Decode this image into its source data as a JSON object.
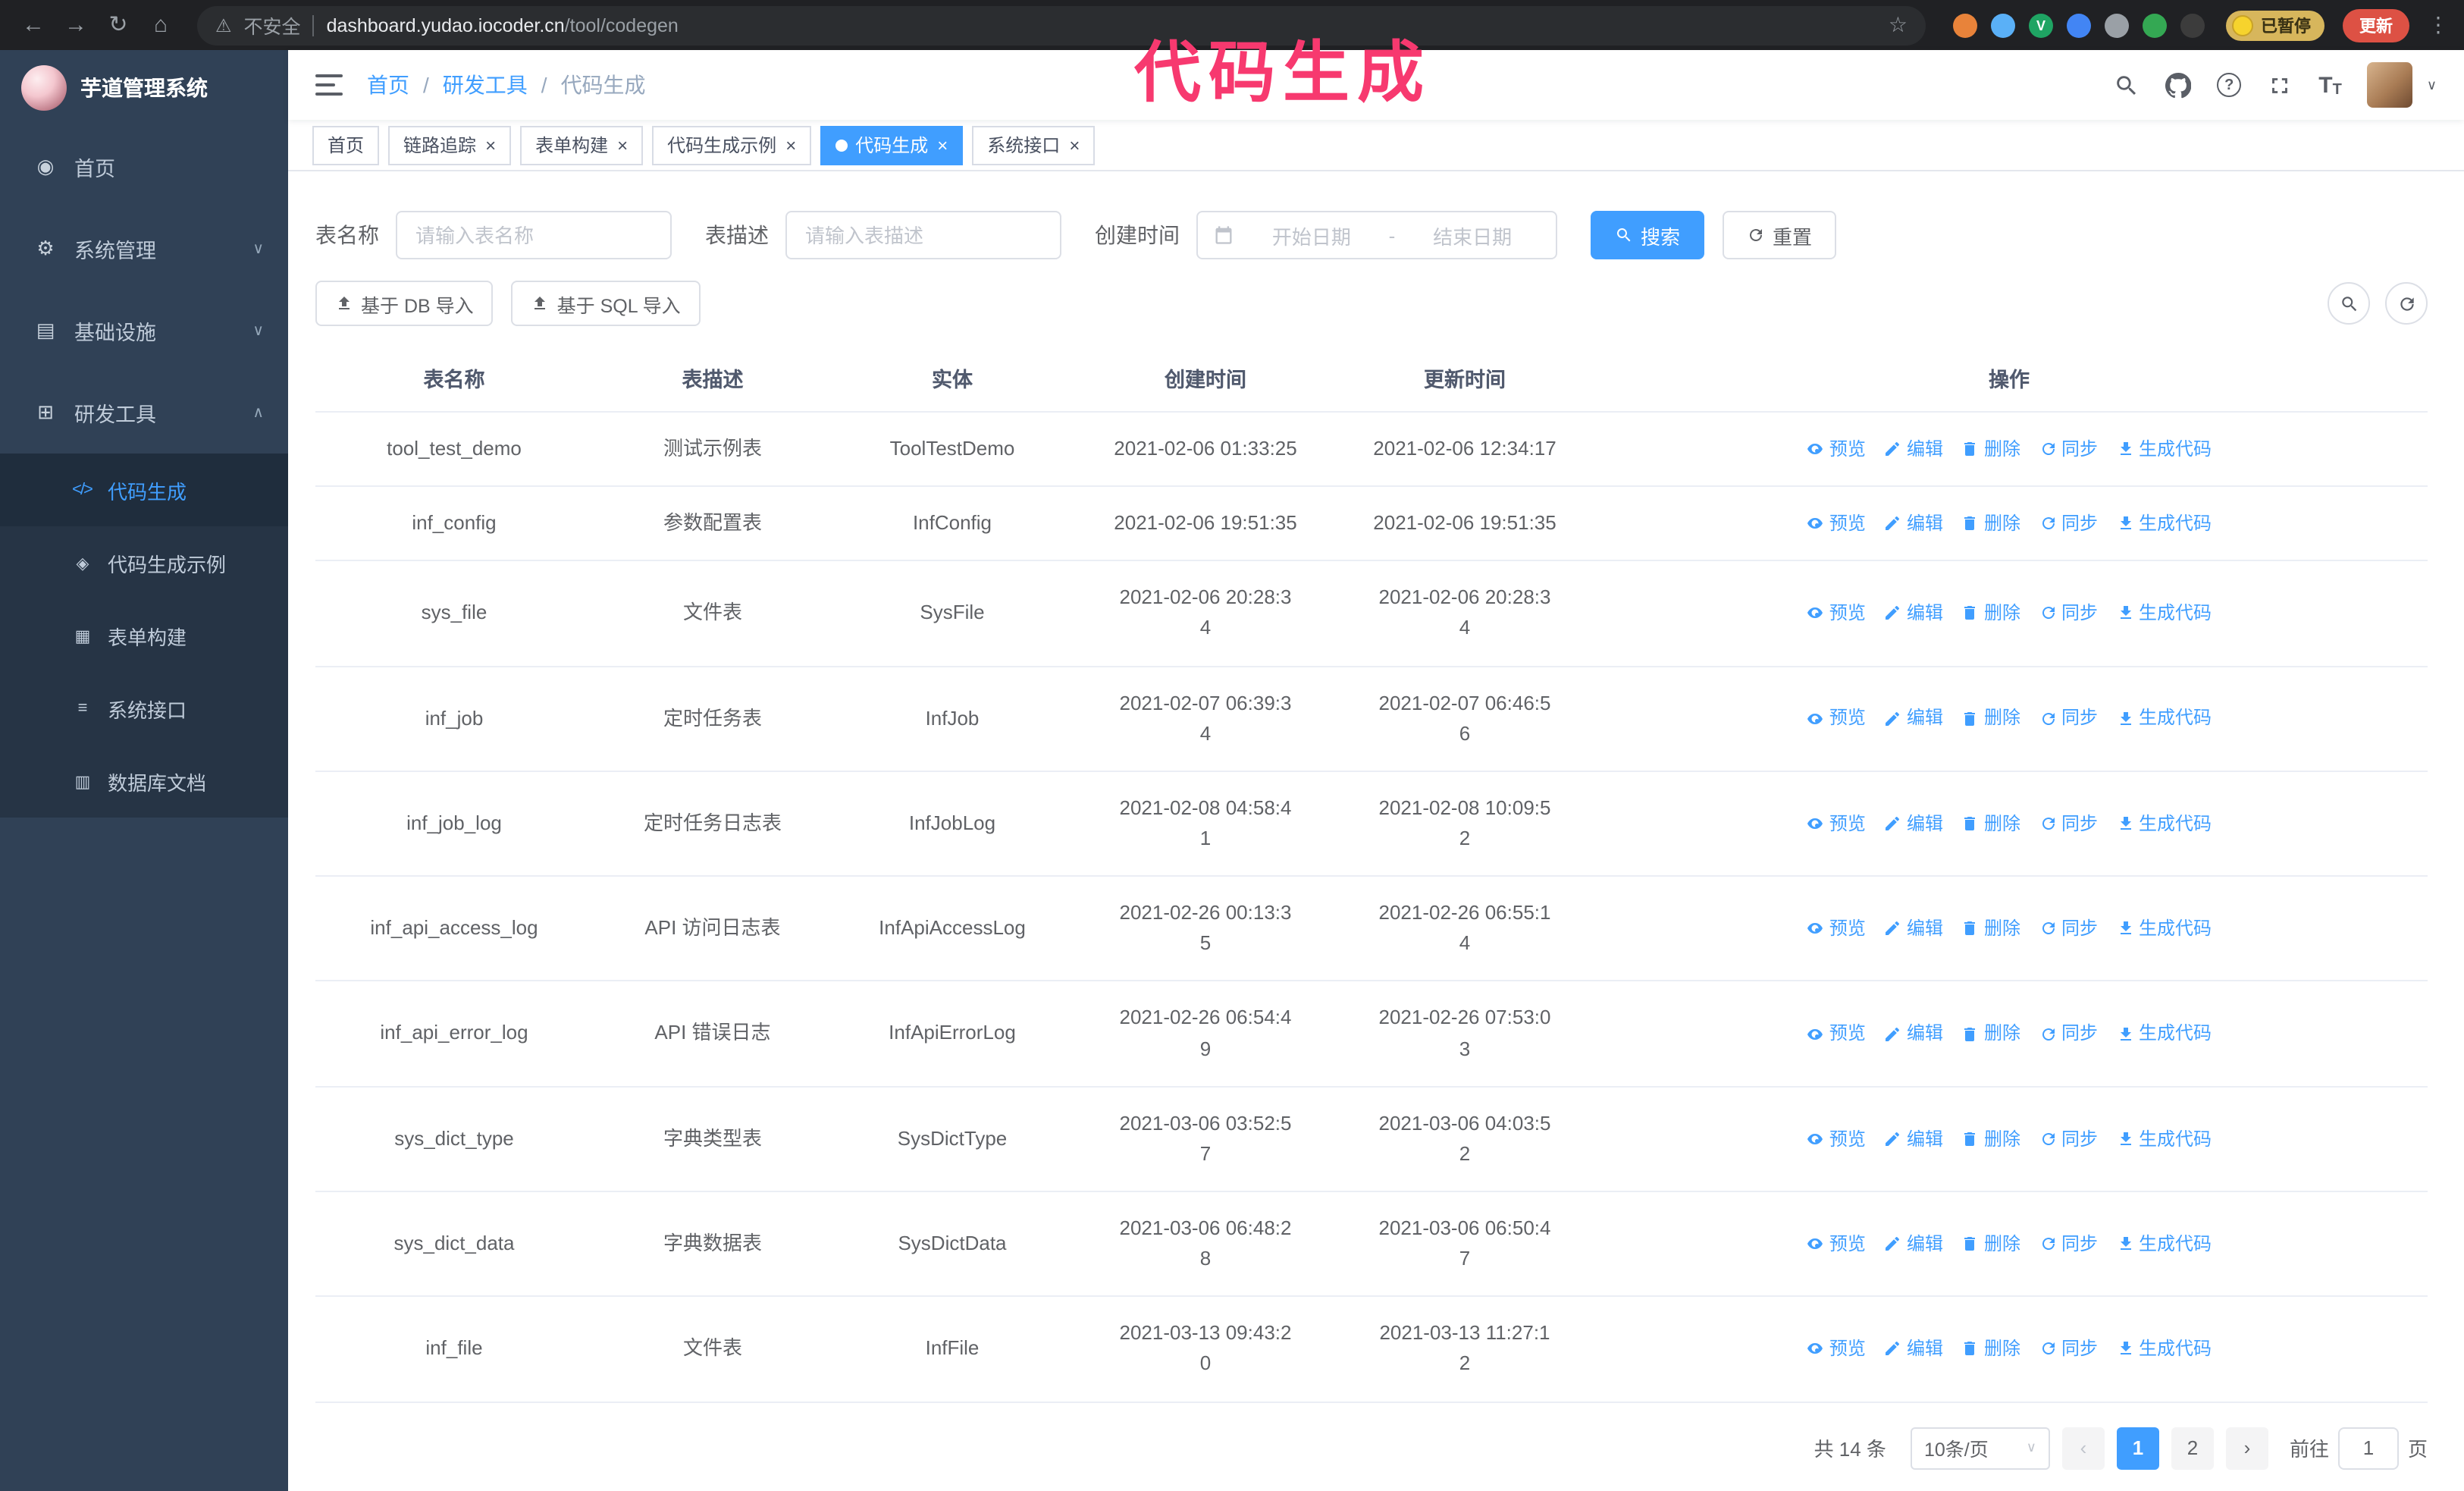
{
  "theme": {
    "primary": "#409eff",
    "sidebar_bg": "#304156",
    "annotation_color": "#f7396f",
    "tab_active_bg": "#409eff"
  },
  "annotation": {
    "text": "代码生成"
  },
  "browser": {
    "back_icon": "←",
    "forward_icon": "→",
    "reload_icon": "↻",
    "home_icon": "⌂",
    "warning_icon": "⚠",
    "security_label": "不安全",
    "url_host": "dashboard.yudao.iocoder.cn",
    "url_path": "/tool/codegen",
    "star_icon": "☆",
    "extensions": [
      {
        "color": "#e8833a",
        "label": ""
      },
      {
        "color": "#5ab0f7",
        "label": ""
      },
      {
        "color": "#1fa463",
        "label": "V"
      },
      {
        "color": "#4285f4",
        "label": ""
      },
      {
        "color": "#9aa0a6",
        "label": ""
      },
      {
        "color": "#34a853",
        "label": ""
      },
      {
        "color": "#3c3c3c",
        "label": ""
      }
    ],
    "paused_badge": "已暂停",
    "update_button": "更新",
    "menu_icon": "⋮"
  },
  "sidebar": {
    "logo_title": "芋道管理系统",
    "items": [
      {
        "label": "首页",
        "glyph": "◉"
      },
      {
        "label": "系统管理",
        "glyph": "⚙",
        "chevron": "∨"
      },
      {
        "label": "基础设施",
        "glyph": "▤",
        "chevron": "∨"
      },
      {
        "label": "研发工具",
        "glyph": "⊞",
        "chevron": "∧",
        "expanded": true
      }
    ],
    "submenu": [
      {
        "label": "代码生成",
        "glyph": "</>",
        "active": true
      },
      {
        "label": "代码生成示例",
        "glyph": "◈"
      },
      {
        "label": "表单构建",
        "glyph": "▦"
      },
      {
        "label": "系统接口",
        "glyph": "≡"
      },
      {
        "label": "数据库文档",
        "glyph": "▥"
      }
    ]
  },
  "header": {
    "breadcrumb": [
      "首页",
      "研发工具",
      "代码生成"
    ],
    "breadcrumb_separator": "/",
    "help_glyph": "?",
    "font_icon_large": "T",
    "font_icon_small": "T",
    "caret_down": "∨"
  },
  "tabs": {
    "close_glyph": "×",
    "items": [
      {
        "label": "首页"
      },
      {
        "label": "链路追踪",
        "closable": true
      },
      {
        "label": "表单构建",
        "closable": true
      },
      {
        "label": "代码生成示例",
        "closable": true
      },
      {
        "label": "代码生成",
        "closable": true,
        "active": true
      },
      {
        "label": "系统接口",
        "closable": true
      }
    ]
  },
  "filters": {
    "table_name_label": "表名称",
    "table_name_placeholder": "请输入表名称",
    "table_desc_label": "表描述",
    "table_desc_placeholder": "请输入表描述",
    "create_time_label": "创建时间",
    "start_placeholder": "开始日期",
    "range_separator": "-",
    "end_placeholder": "结束日期",
    "search_label": "搜索",
    "reset_label": "重置"
  },
  "toolbar": {
    "db_import_label": "基于 DB 导入",
    "sql_import_label": "基于 SQL 导入"
  },
  "table": {
    "columns": [
      "表名称",
      "表描述",
      "实体",
      "创建时间",
      "更新时间",
      "操作"
    ],
    "action_labels": [
      "预览",
      "编辑",
      "删除",
      "同步",
      "生成代码"
    ],
    "rows": [
      {
        "name": "tool_test_demo",
        "desc": "测试示例表",
        "entity": "ToolTestDemo",
        "created": "2021-02-06 01:33:25",
        "updated": "2021-02-06 12:34:17",
        "time_nowrap": true
      },
      {
        "name": "inf_config",
        "desc": "参数配置表",
        "entity": "InfConfig",
        "created": "2021-02-06 19:51:35",
        "updated": "2021-02-06 19:51:35",
        "time_nowrap": true
      },
      {
        "name": "sys_file",
        "desc": "文件表",
        "entity": "SysFile",
        "created": "2021-02-06 20:28:34",
        "updated": "2021-02-06 20:28:34"
      },
      {
        "name": "inf_job",
        "desc": "定时任务表",
        "entity": "InfJob",
        "created": "2021-02-07 06:39:34",
        "updated": "2021-02-07 06:46:56"
      },
      {
        "name": "inf_job_log",
        "desc": "定时任务日志表",
        "entity": "InfJobLog",
        "created": "2021-02-08 04:58:41",
        "updated": "2021-02-08 10:09:52"
      },
      {
        "name": "inf_api_access_log",
        "desc": "API 访问日志表",
        "entity": "InfApiAccessLog",
        "created": "2021-02-26 00:13:35",
        "updated": "2021-02-26 06:55:14"
      },
      {
        "name": "inf_api_error_log",
        "desc": "API 错误日志",
        "entity": "InfApiErrorLog",
        "created": "2021-02-26 06:54:49",
        "updated": "2021-02-26 07:53:03"
      },
      {
        "name": "sys_dict_type",
        "desc": "字典类型表",
        "entity": "SysDictType",
        "created": "2021-03-06 03:52:57",
        "updated": "2021-03-06 04:03:52"
      },
      {
        "name": "sys_dict_data",
        "desc": "字典数据表",
        "entity": "SysDictData",
        "created": "2021-03-06 06:48:28",
        "updated": "2021-03-06 06:50:47"
      },
      {
        "name": "inf_file",
        "desc": "文件表",
        "entity": "InfFile",
        "created": "2021-03-13 09:43:20",
        "updated": "2021-03-13 11:27:12"
      }
    ]
  },
  "pagination": {
    "total_text": "共 14 条",
    "page_size_text": "10条/页",
    "prev_icon": "‹",
    "next_icon": "›",
    "pages": [
      {
        "label": "1",
        "active": true
      },
      {
        "label": "2"
      }
    ],
    "goto_label": "前往",
    "goto_value": "1",
    "page_unit": "页"
  }
}
